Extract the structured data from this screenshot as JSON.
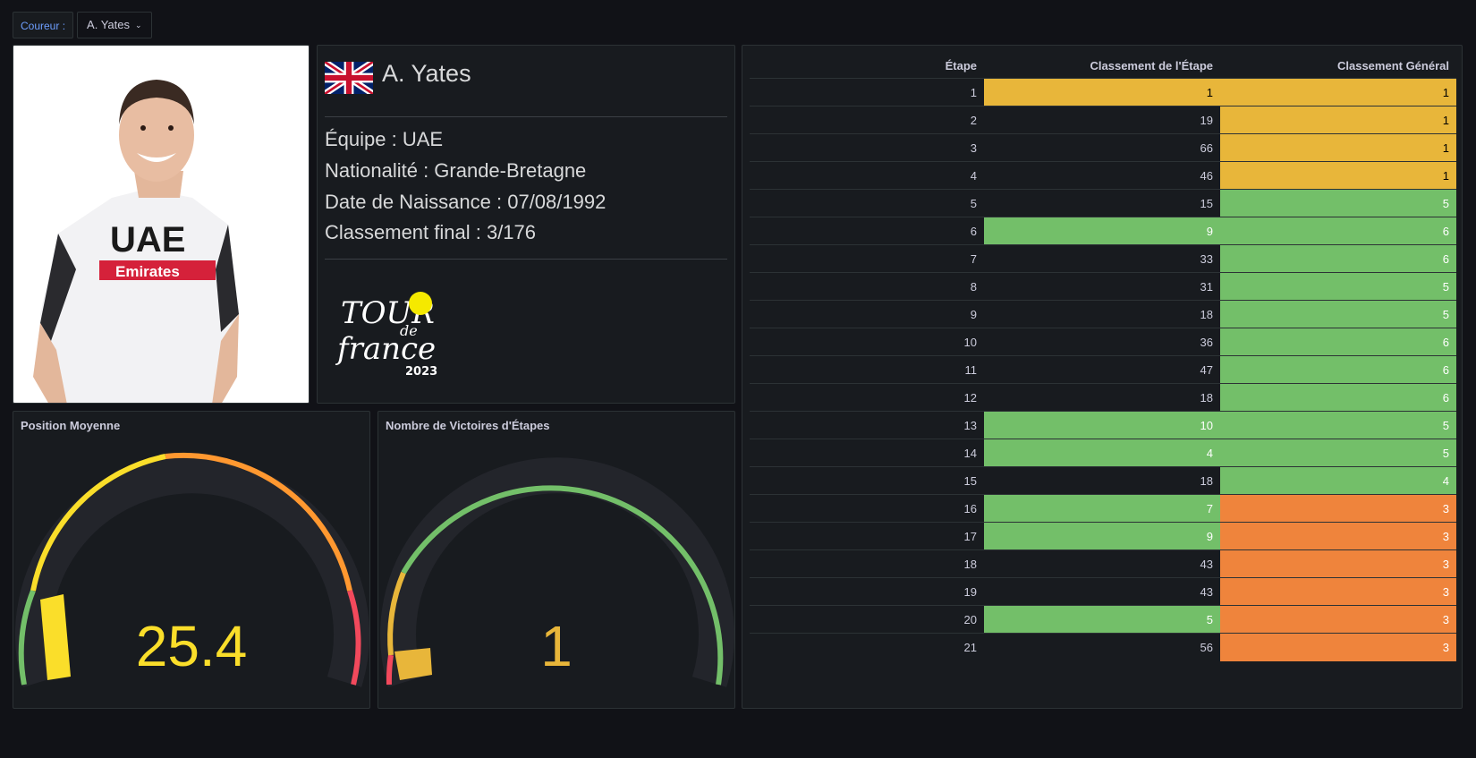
{
  "variable": {
    "label": "Coureur :",
    "value": "A. Yates"
  },
  "rider": {
    "name": "A. Yates",
    "team": "Équipe : UAE",
    "nationality": "Nationalité : Grande-Bretagne",
    "birth": "Date de Naissance : 07/08/1992",
    "final": "Classement final : 3/176",
    "flag_icon": "uk-flag-icon"
  },
  "gauges": [
    {
      "title": "Position Moyenne",
      "value": "25.4",
      "color": "#fade2a",
      "fraction": 0.14
    },
    {
      "title": "Nombre de Victoires d'Étapes",
      "value": "1",
      "color": "#e8b63a",
      "fraction": 0.1
    }
  ],
  "table": {
    "headers": [
      "Étape",
      "Classement de l'Étape",
      "Classement Général"
    ],
    "rows": [
      [
        "1",
        "1",
        "1"
      ],
      [
        "2",
        "19",
        "1"
      ],
      [
        "3",
        "66",
        "1"
      ],
      [
        "4",
        "46",
        "1"
      ],
      [
        "5",
        "15",
        "5"
      ],
      [
        "6",
        "9",
        "6"
      ],
      [
        "7",
        "33",
        "6"
      ],
      [
        "8",
        "31",
        "5"
      ],
      [
        "9",
        "18",
        "5"
      ],
      [
        "10",
        "36",
        "6"
      ],
      [
        "11",
        "47",
        "6"
      ],
      [
        "12",
        "18",
        "6"
      ],
      [
        "13",
        "10",
        "5"
      ],
      [
        "14",
        "4",
        "5"
      ],
      [
        "15",
        "18",
        "4"
      ],
      [
        "16",
        "7",
        "3"
      ],
      [
        "17",
        "9",
        "3"
      ],
      [
        "18",
        "43",
        "3"
      ],
      [
        "19",
        "43",
        "3"
      ],
      [
        "20",
        "5",
        "3"
      ],
      [
        "21",
        "56",
        "3"
      ]
    ],
    "stage_colors": [
      "gold",
      "none",
      "none",
      "none",
      "none",
      "green",
      "none",
      "none",
      "none",
      "none",
      "none",
      "none",
      "green",
      "green",
      "none",
      "green",
      "green",
      "none",
      "none",
      "green",
      "none"
    ],
    "general_colors": [
      "gold",
      "gold",
      "gold",
      "gold",
      "green",
      "green",
      "green",
      "green",
      "green",
      "green",
      "green",
      "green",
      "green",
      "green",
      "green",
      "orange",
      "orange",
      "orange",
      "orange",
      "orange",
      "orange"
    ]
  },
  "colors": {
    "gold": "#e8b63a",
    "green": "#73bf69",
    "orange": "#ef843c"
  }
}
